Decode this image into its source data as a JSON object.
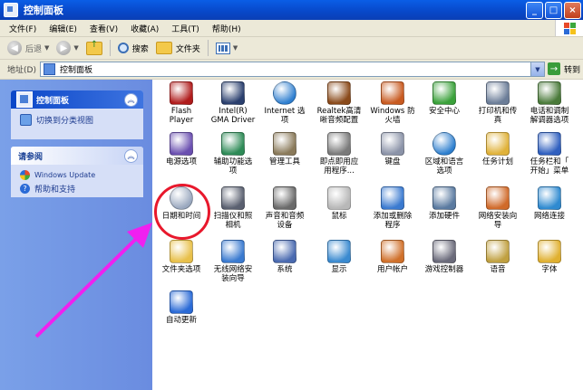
{
  "window": {
    "title": "控制面板"
  },
  "menu": [
    "文件(F)",
    "编辑(E)",
    "查看(V)",
    "收藏(A)",
    "工具(T)",
    "帮助(H)"
  ],
  "toolbar": {
    "back": "后退",
    "search": "搜索",
    "folders": "文件夹"
  },
  "address": {
    "label": "地址(D)",
    "value": "控制面板",
    "go": "转到"
  },
  "sidebar": {
    "control_panel": {
      "title": "控制面板",
      "link": "切换到分类视图"
    },
    "see_also": {
      "title": "请参阅",
      "links": [
        "Windows Update",
        "帮助和支持"
      ]
    }
  },
  "items": [
    {
      "label": "Flash\nPlayer",
      "icon": "flash-icon"
    },
    {
      "label": "Intel(R)\nGMA Driver",
      "icon": "monitor-icon"
    },
    {
      "label": "Internet 选\n项",
      "icon": "globe-icon"
    },
    {
      "label": "Realtek高清\n晰音频配置",
      "icon": "speaker-icon"
    },
    {
      "label": "Windows 防\n火墙",
      "icon": "firewall-icon"
    },
    {
      "label": "安全中心",
      "icon": "shield-icon"
    },
    {
      "label": "打印机和传\n真",
      "icon": "printer-icon"
    },
    {
      "label": "电话和调制\n解调器选项",
      "icon": "phone-icon"
    },
    {
      "label": "电源选项",
      "icon": "power-icon"
    },
    {
      "label": "辅助功能选\n项",
      "icon": "accessibility-icon"
    },
    {
      "label": "管理工具",
      "icon": "admin-tools-icon"
    },
    {
      "label": "即点即用应\n用程序...",
      "icon": "document-icon"
    },
    {
      "label": "键盘",
      "icon": "keyboard-icon"
    },
    {
      "label": "区域和语言\n选项",
      "icon": "globe-clock-icon"
    },
    {
      "label": "任务计划",
      "icon": "folder-clock-icon"
    },
    {
      "label": "任务栏和「\n开始」菜单",
      "icon": "taskbar-icon"
    },
    {
      "label": "日期和时间",
      "icon": "clock-icon"
    },
    {
      "label": "扫描仪和照\n相机",
      "icon": "camera-icon"
    },
    {
      "label": "声音和音频\n设备",
      "icon": "sound-icon"
    },
    {
      "label": "鼠标",
      "icon": "mouse-icon"
    },
    {
      "label": "添加或删除\n程序",
      "icon": "add-remove-icon"
    },
    {
      "label": "添加硬件",
      "icon": "hardware-icon"
    },
    {
      "label": "网络安装向\n导",
      "icon": "network-home-icon"
    },
    {
      "label": "网络连接",
      "icon": "network-icon"
    },
    {
      "label": "文件夹选项",
      "icon": "folder-icon"
    },
    {
      "label": "无线网络安\n装向导",
      "icon": "wireless-icon"
    },
    {
      "label": "系统",
      "icon": "system-icon"
    },
    {
      "label": "显示",
      "icon": "display-icon"
    },
    {
      "label": "用户帐户",
      "icon": "users-icon"
    },
    {
      "label": "游戏控制器",
      "icon": "gamepad-icon"
    },
    {
      "label": "语音",
      "icon": "speech-icon"
    },
    {
      "label": "字体",
      "icon": "fonts-icon"
    },
    {
      "label": "自动更新",
      "icon": "update-icon"
    }
  ]
}
